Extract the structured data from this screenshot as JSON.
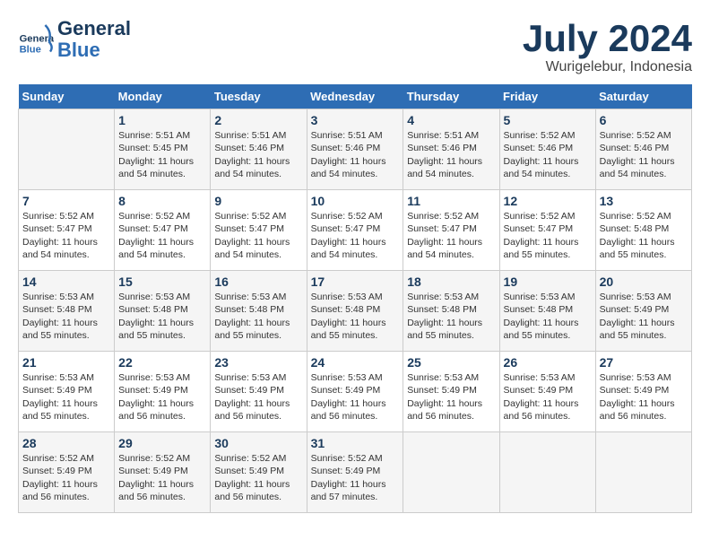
{
  "header": {
    "logo_line1": "General",
    "logo_line2": "Blue",
    "month": "July 2024",
    "location": "Wurigelebur, Indonesia"
  },
  "weekdays": [
    "Sunday",
    "Monday",
    "Tuesday",
    "Wednesday",
    "Thursday",
    "Friday",
    "Saturday"
  ],
  "weeks": [
    [
      {
        "day": "",
        "info": ""
      },
      {
        "day": "1",
        "info": "Sunrise: 5:51 AM\nSunset: 5:45 PM\nDaylight: 11 hours\nand 54 minutes."
      },
      {
        "day": "2",
        "info": "Sunrise: 5:51 AM\nSunset: 5:46 PM\nDaylight: 11 hours\nand 54 minutes."
      },
      {
        "day": "3",
        "info": "Sunrise: 5:51 AM\nSunset: 5:46 PM\nDaylight: 11 hours\nand 54 minutes."
      },
      {
        "day": "4",
        "info": "Sunrise: 5:51 AM\nSunset: 5:46 PM\nDaylight: 11 hours\nand 54 minutes."
      },
      {
        "day": "5",
        "info": "Sunrise: 5:52 AM\nSunset: 5:46 PM\nDaylight: 11 hours\nand 54 minutes."
      },
      {
        "day": "6",
        "info": "Sunrise: 5:52 AM\nSunset: 5:46 PM\nDaylight: 11 hours\nand 54 minutes."
      }
    ],
    [
      {
        "day": "7",
        "info": "Sunrise: 5:52 AM\nSunset: 5:47 PM\nDaylight: 11 hours\nand 54 minutes."
      },
      {
        "day": "8",
        "info": "Sunrise: 5:52 AM\nSunset: 5:47 PM\nDaylight: 11 hours\nand 54 minutes."
      },
      {
        "day": "9",
        "info": "Sunrise: 5:52 AM\nSunset: 5:47 PM\nDaylight: 11 hours\nand 54 minutes."
      },
      {
        "day": "10",
        "info": "Sunrise: 5:52 AM\nSunset: 5:47 PM\nDaylight: 11 hours\nand 54 minutes."
      },
      {
        "day": "11",
        "info": "Sunrise: 5:52 AM\nSunset: 5:47 PM\nDaylight: 11 hours\nand 54 minutes."
      },
      {
        "day": "12",
        "info": "Sunrise: 5:52 AM\nSunset: 5:47 PM\nDaylight: 11 hours\nand 55 minutes."
      },
      {
        "day": "13",
        "info": "Sunrise: 5:52 AM\nSunset: 5:48 PM\nDaylight: 11 hours\nand 55 minutes."
      }
    ],
    [
      {
        "day": "14",
        "info": "Sunrise: 5:53 AM\nSunset: 5:48 PM\nDaylight: 11 hours\nand 55 minutes."
      },
      {
        "day": "15",
        "info": "Sunrise: 5:53 AM\nSunset: 5:48 PM\nDaylight: 11 hours\nand 55 minutes."
      },
      {
        "day": "16",
        "info": "Sunrise: 5:53 AM\nSunset: 5:48 PM\nDaylight: 11 hours\nand 55 minutes."
      },
      {
        "day": "17",
        "info": "Sunrise: 5:53 AM\nSunset: 5:48 PM\nDaylight: 11 hours\nand 55 minutes."
      },
      {
        "day": "18",
        "info": "Sunrise: 5:53 AM\nSunset: 5:48 PM\nDaylight: 11 hours\nand 55 minutes."
      },
      {
        "day": "19",
        "info": "Sunrise: 5:53 AM\nSunset: 5:48 PM\nDaylight: 11 hours\nand 55 minutes."
      },
      {
        "day": "20",
        "info": "Sunrise: 5:53 AM\nSunset: 5:49 PM\nDaylight: 11 hours\nand 55 minutes."
      }
    ],
    [
      {
        "day": "21",
        "info": "Sunrise: 5:53 AM\nSunset: 5:49 PM\nDaylight: 11 hours\nand 55 minutes."
      },
      {
        "day": "22",
        "info": "Sunrise: 5:53 AM\nSunset: 5:49 PM\nDaylight: 11 hours\nand 56 minutes."
      },
      {
        "day": "23",
        "info": "Sunrise: 5:53 AM\nSunset: 5:49 PM\nDaylight: 11 hours\nand 56 minutes."
      },
      {
        "day": "24",
        "info": "Sunrise: 5:53 AM\nSunset: 5:49 PM\nDaylight: 11 hours\nand 56 minutes."
      },
      {
        "day": "25",
        "info": "Sunrise: 5:53 AM\nSunset: 5:49 PM\nDaylight: 11 hours\nand 56 minutes."
      },
      {
        "day": "26",
        "info": "Sunrise: 5:53 AM\nSunset: 5:49 PM\nDaylight: 11 hours\nand 56 minutes."
      },
      {
        "day": "27",
        "info": "Sunrise: 5:53 AM\nSunset: 5:49 PM\nDaylight: 11 hours\nand 56 minutes."
      }
    ],
    [
      {
        "day": "28",
        "info": "Sunrise: 5:52 AM\nSunset: 5:49 PM\nDaylight: 11 hours\nand 56 minutes."
      },
      {
        "day": "29",
        "info": "Sunrise: 5:52 AM\nSunset: 5:49 PM\nDaylight: 11 hours\nand 56 minutes."
      },
      {
        "day": "30",
        "info": "Sunrise: 5:52 AM\nSunset: 5:49 PM\nDaylight: 11 hours\nand 56 minutes."
      },
      {
        "day": "31",
        "info": "Sunrise: 5:52 AM\nSunset: 5:49 PM\nDaylight: 11 hours\nand 57 minutes."
      },
      {
        "day": "",
        "info": ""
      },
      {
        "day": "",
        "info": ""
      },
      {
        "day": "",
        "info": ""
      }
    ]
  ]
}
